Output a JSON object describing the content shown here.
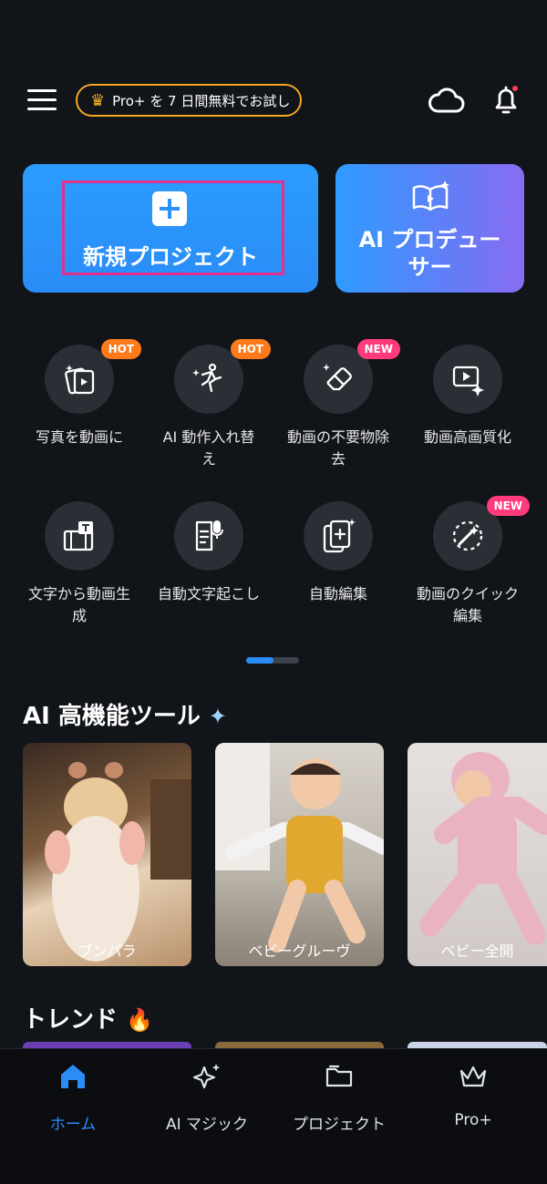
{
  "top_bar": {
    "promo_text": "Pro+ を 7 日間無料でお試し",
    "icons": [
      "menu-icon",
      "crown-icon",
      "cloud-icon",
      "bell-icon"
    ]
  },
  "hero": {
    "new_project_label": "新規プロジェクト",
    "ai_producer_line1": "AI プロデュー",
    "ai_producer_line2": "サー"
  },
  "tools": [
    {
      "line1": "写真を動画に",
      "line2": "",
      "badge": "HOT"
    },
    {
      "line1": "AI 動作入れ替",
      "line2": "え",
      "badge": "HOT"
    },
    {
      "line1": "動画の不要物除",
      "line2": "去",
      "badge": "NEW"
    },
    {
      "line1": "動画高画質化",
      "line2": "",
      "badge": ""
    },
    {
      "line1": "文字から動画生",
      "line2": "成",
      "badge": ""
    },
    {
      "line1": "自動文字起こし",
      "line2": "",
      "badge": ""
    },
    {
      "line1": "自動編集",
      "line2": "",
      "badge": ""
    },
    {
      "line1": "動画のクイック",
      "line2": "編集",
      "badge": "NEW"
    }
  ],
  "ai_tools": {
    "title": "AI 高機能ツール",
    "cards": [
      {
        "caption": "ブンパラ"
      },
      {
        "caption": "ベビーグルーヴ"
      },
      {
        "caption": "ベビー全開"
      }
    ]
  },
  "trend": {
    "title": "トレンド"
  },
  "bottom_nav": {
    "home": "ホーム",
    "ai_magic": "AI マジック",
    "projects": "プロジェクト",
    "pro": "Pro+"
  },
  "colors": {
    "accent": "#2a8cf6",
    "hot": "#ff7a1a",
    "new": "#ff3b7c",
    "highlight": "#e0318f",
    "promo_border": "#f5a623"
  }
}
